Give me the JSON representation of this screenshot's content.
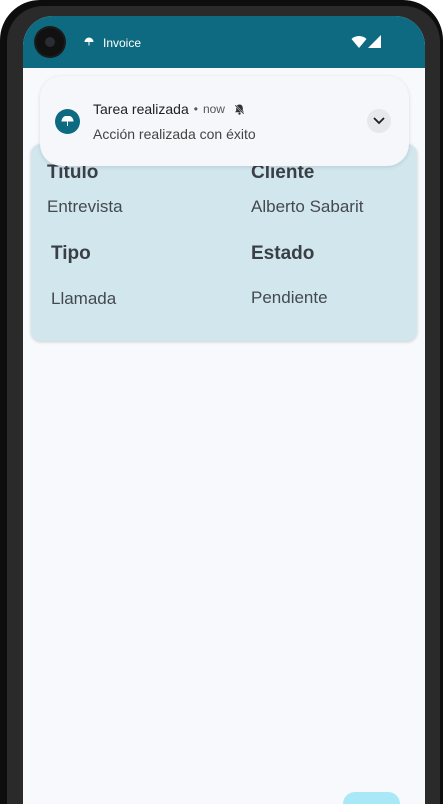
{
  "status_bar": {
    "app_label": "Invoice",
    "app_icon": "umbrella-icon",
    "wifi_icon": "wifi-icon",
    "signal_icon": "signal-icon",
    "background": "#0d6a80"
  },
  "notification": {
    "title": "Tarea realizada",
    "separator": "•",
    "time": "now",
    "alert_icon": "bell-icon",
    "body": "Acción realizada con éxito",
    "expand_icon": "chevron-down-icon"
  },
  "card": {
    "fields": [
      {
        "label": "Titulo",
        "value": "Entrevista"
      },
      {
        "label": "Cliente",
        "value": "Alberto Sabarit"
      },
      {
        "label": "Tipo",
        "value": "Llamada"
      },
      {
        "label": "Estado",
        "value": "Pendiente"
      }
    ],
    "background": "#d1e6ed"
  },
  "fab": {
    "color": "#a8e8f7"
  }
}
